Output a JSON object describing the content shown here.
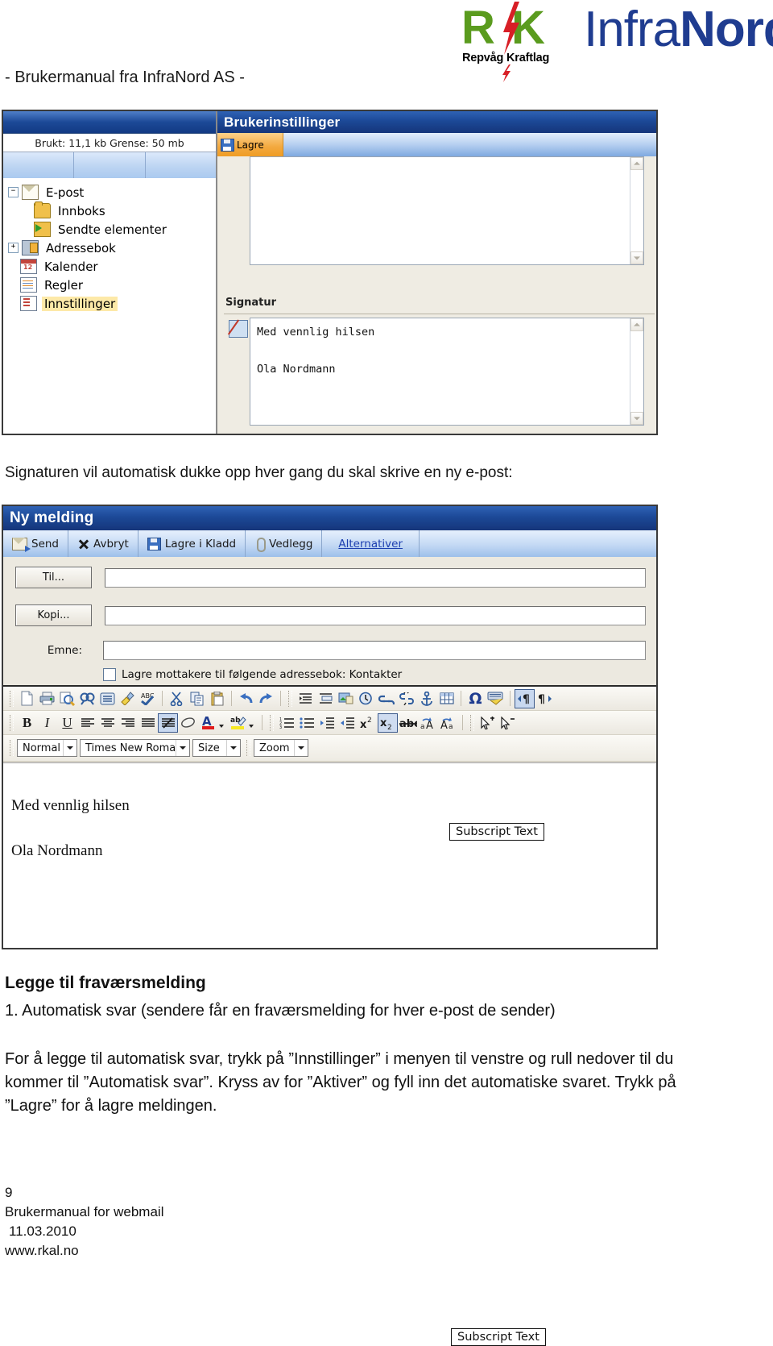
{
  "header": {
    "doc_title": "- Brukermanual fra InfraNord AS -",
    "logo": {
      "rk_letters": "R K",
      "rk_sub": "Repvåg Kraftlag",
      "infranord_light": "Infra",
      "infranord_bold": "Nord",
      "green": "#5a9b1e",
      "red": "#d81f26",
      "blue": "#1f3c90"
    }
  },
  "settings_window": {
    "sidebar": {
      "quota": "Brukt: 11,1 kb Grense: 50 mb",
      "tree": [
        {
          "label": "E-post",
          "icon": "mail-icon",
          "expander": "-",
          "indent": 0
        },
        {
          "label": "Innboks",
          "icon": "folder-icon",
          "expander": "",
          "indent": 1
        },
        {
          "label": "Sendte elementer",
          "icon": "folder-sent-icon",
          "expander": "",
          "indent": 1
        },
        {
          "label": "Adressebok",
          "icon": "addressbook-icon",
          "expander": "+",
          "indent": 0
        },
        {
          "label": "Kalender",
          "icon": "calendar-icon",
          "expander": "",
          "indent": 0
        },
        {
          "label": "Regler",
          "icon": "rules-icon",
          "expander": "",
          "indent": 0
        },
        {
          "label": "Innstillinger",
          "icon": "settings-icon",
          "expander": "",
          "indent": 0,
          "selected": true
        }
      ]
    },
    "title": "Brukerinstillinger",
    "save_label": "Lagre",
    "signature_label": "Signatur",
    "signature_line1": "Med vennlig hilsen",
    "signature_line2": "Ola Nordmann"
  },
  "caption": "Signaturen vil automatisk dukke opp hver gang du skal skrive en ny e-post:",
  "compose_window": {
    "title": "Ny melding",
    "toolbar": [
      {
        "label": "Send",
        "icon": "send-icon"
      },
      {
        "label": "Avbryt",
        "icon": "cancel-x-icon"
      },
      {
        "label": "Lagre i Kladd",
        "icon": "save-disk-icon"
      },
      {
        "label": "Vedlegg",
        "icon": "paperclip-icon"
      },
      {
        "label": "Alternativer",
        "icon": "options-link",
        "link": true
      }
    ],
    "fields": {
      "to_button": "Til...",
      "to_value": "",
      "cc_button": "Kopi...",
      "cc_value": "",
      "subject_label": "Emne:",
      "subject_value": "",
      "save_recipients_label": "Lagre mottakere til følgende adressebok: Kontakter",
      "save_recipients_checked": false
    },
    "editor": {
      "row1_icons": [
        "new-document-icon",
        "print-icon",
        "print-preview-icon",
        "find-icon",
        "merge-icon",
        "clean-brush-icon",
        "spellcheck-icon",
        "cut-icon",
        "copy-icon",
        "paste-icon",
        "undo-icon",
        "redo-icon",
        "indent-paragraph-icon",
        "insert-page-break-icon",
        "insert-image-icon",
        "insert-time-icon",
        "insert-link-icon",
        "remove-link-icon",
        "anchor-icon",
        "insert-table-icon",
        "special-character-icon",
        "keyboard-icon",
        "ltr-direction-icon",
        "rtl-direction-icon"
      ],
      "row2_icons": [
        "bold-icon",
        "italic-icon",
        "underline-icon",
        "align-left-icon",
        "align-center-icon",
        "align-right-icon",
        "justify-icon",
        "remove-format-icon",
        "eraser-icon",
        "font-color-icon",
        "highlight-color-icon",
        "numbered-list-icon",
        "bullet-list-icon",
        "indent-increase-icon",
        "indent-decrease-icon",
        "superscript-icon",
        "subscript-icon",
        "strikethrough-icon",
        "uppercase-icon",
        "lowercase-icon",
        "select-add-icon",
        "select-remove-icon"
      ],
      "dropdowns": [
        {
          "label": "Normal",
          "name": "style-dropdown"
        },
        {
          "label": "Times New Roman",
          "name": "font-dropdown"
        },
        {
          "label": "Size",
          "name": "size-dropdown"
        },
        {
          "label": "Zoom",
          "name": "zoom-dropdown"
        }
      ],
      "tooltip": "Subscript Text",
      "body_line1": "Med vennlig hilsen",
      "body_line2": "Ola Nordmann"
    }
  },
  "content": {
    "heading": "Legge til fraværsmelding",
    "numbered_line": "1. Automatisk svar (sendere får en fraværsmelding for hver e-post de sender)",
    "paragraph": "For å legge til automatisk svar, trykk på ”Innstillinger” i menyen til venstre og rull nedover til du kommer til ”Automatisk svar”. Kryss av for ”Aktiver” og fyll inn det automatiske svaret. Trykk på ”Lagre” for å lagre meldingen."
  },
  "footer": {
    "page_number": "9",
    "title": "Brukermanual for webmail",
    "date": "11.03.2010",
    "url": "www.rkal.no"
  }
}
